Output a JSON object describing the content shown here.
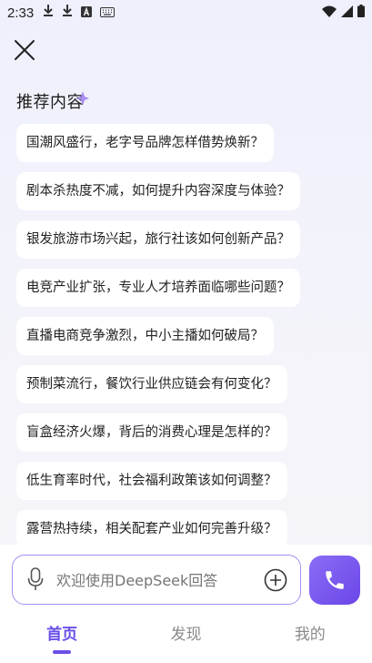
{
  "status_bar": {
    "time": "2:33",
    "left_icons": [
      "download-icon",
      "download-icon",
      "text-a-icon",
      "keyboard-icon"
    ],
    "right_icons": [
      "wifi-icon",
      "signal-icon",
      "battery-icon"
    ]
  },
  "header": {
    "close_icon": "close-icon",
    "section_title": "推荐内容"
  },
  "recommendations": [
    "国潮风盛行，老字号品牌怎样借势焕新？",
    "剧本杀热度不减，如何提升内容深度与体验？",
    "银发旅游市场兴起，旅行社该如何创新产品？",
    "电竞产业扩张，专业人才培养面临哪些问题？",
    "直播电商竞争激烈，中小主播如何破局？",
    "预制菜流行，餐饮行业供应链会有何变化？",
    "盲盒经济火爆，背后的消费心理是怎样的？",
    "低生育率时代，社会福利政策该如何调整？",
    "露营热持续，相关配套产业如何完善升级？"
  ],
  "input": {
    "placeholder": "欢迎使用DeepSeek回答",
    "mic_icon": "microphone-icon",
    "add_icon": "plus-circle-icon"
  },
  "call_button": {
    "icon": "phone-icon"
  },
  "tabs": [
    {
      "label": "首页",
      "active": true
    },
    {
      "label": "发现",
      "active": false
    },
    {
      "label": "我的",
      "active": false
    }
  ],
  "colors": {
    "accent": "#6a4ee8",
    "input_border": "#a98ef0"
  }
}
